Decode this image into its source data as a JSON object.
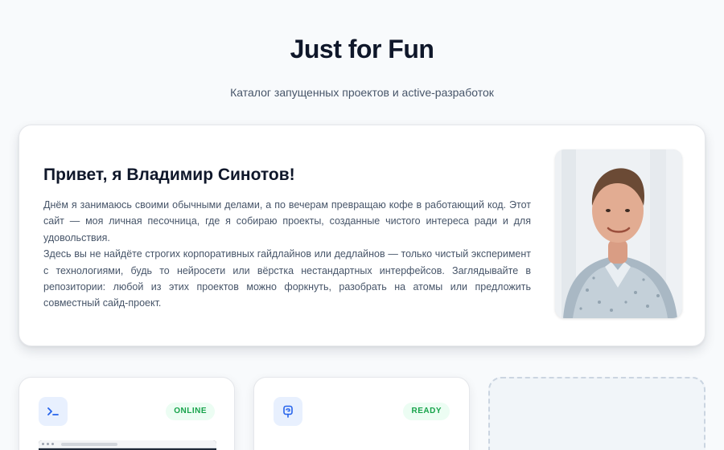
{
  "header": {
    "title": "Just for Fun",
    "subtitle": "Каталог запущенных проектов и active-разработок"
  },
  "intro": {
    "heading": "Привет, я Владимир Синотов!",
    "paragraph_1": "Днём я занимаюсь своими обычными делами, а по вечерам превращаю кофе в работающий код. Этот сайт — моя личная песочница, где я собираю проекты, созданные чистого интереса ради и для удовольствия.",
    "paragraph_2": "Здесь вы не найдёте строгих корпоративных гайдлайнов или дедлайнов — только чистый эксперимент с технологиями, будь то нейросети или вёрстка нестандартных интерфейсов. Заглядывайте в репозитории: любой из этих проектов можно форкнуть, разобрать на атомы или предложить совместный сайд-проект."
  },
  "projects": [
    {
      "icon": "terminal-icon",
      "status": "ONLINE"
    },
    {
      "icon": "widget-icon",
      "status": "READY"
    },
    {
      "placeholder": true
    }
  ],
  "colors": {
    "accent": "#2563eb",
    "status_green": "#16a34a",
    "status_bg": "#ecfdf3",
    "page_bg": "#f8fafc"
  }
}
